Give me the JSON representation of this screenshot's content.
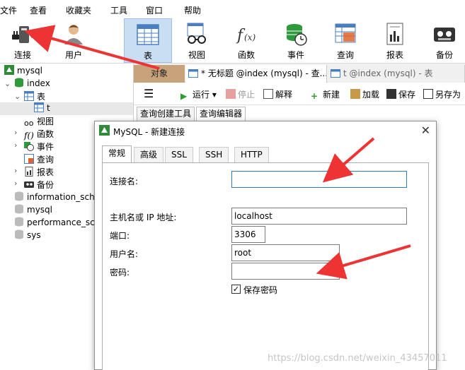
{
  "menu": [
    "文件",
    "查看",
    "收藏夹",
    "工具",
    "窗口",
    "帮助"
  ],
  "toolbar": [
    {
      "label": "连接",
      "icon": "connection-plug-icon"
    },
    {
      "label": "用户",
      "icon": "user-icon"
    },
    {
      "label": "表",
      "icon": "table-icon",
      "active": true
    },
    {
      "label": "视图",
      "icon": "view-glasses-icon"
    },
    {
      "label": "函数",
      "icon": "function-icon"
    },
    {
      "label": "事件",
      "icon": "event-clock-icon"
    },
    {
      "label": "查询",
      "icon": "query-icon"
    },
    {
      "label": "报表",
      "icon": "report-icon"
    },
    {
      "label": "备份",
      "icon": "backup-icon"
    }
  ],
  "tree": {
    "connection": "mysql",
    "database": "index",
    "tables_label": "表",
    "table_t": "t",
    "views": "视图",
    "functions": "函数",
    "events": "事件",
    "queries": "查询",
    "reports": "报表",
    "backups": "备份",
    "other_dbs": [
      "information_sche",
      "mysql",
      "performance_sch",
      "sys"
    ]
  },
  "tabs": {
    "object": "对象",
    "query_tab": "* 无标题 @index (mysql) - 查...",
    "table_tab": "t @index (mysql) - 表"
  },
  "query_toolbar": {
    "run": "运行",
    "stop": "停止",
    "explain": "解释",
    "new": "新建",
    "load": "加载",
    "save": "保存",
    "save_as": "另存为"
  },
  "subtabs": [
    "查询创建工具",
    "查询编辑器"
  ],
  "dialog": {
    "title": "MySQL - 新建连接",
    "tabs": [
      "常规",
      "高级",
      "SSL",
      "SSH",
      "HTTP"
    ],
    "fields": {
      "conn_name_label": "连接名:",
      "conn_name_value": "",
      "host_label": "主机名或 IP 地址:",
      "host_value": "localhost",
      "port_label": "端口:",
      "port_value": "3306",
      "user_label": "用户名:",
      "user_value": "root",
      "password_label": "密码:",
      "password_value": "",
      "save_password_label": "保存密码"
    }
  },
  "watermark": "https://blog.csdn.net/weixin_43457011",
  "colors": {
    "arrow": "#ee3333",
    "active_tab": "#c9ddf3",
    "object_tab": "#c8a27a",
    "focus_border": "#2f77c9"
  }
}
